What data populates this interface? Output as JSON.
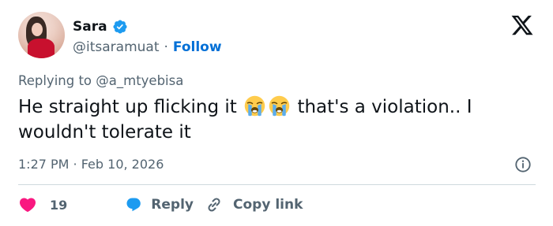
{
  "user": {
    "display_name": "Sara",
    "handle": "@itsaramuat",
    "separator": "·",
    "follow_label": "Follow"
  },
  "tweet": {
    "replying_to": "Replying to @a_mtyebisa",
    "text_part1": "He straight up flicking it",
    "text_part2": "that's a violation.. I wouldn't tolerate it",
    "emojis": [
      "loudly-crying-face",
      "loudly-crying-face"
    ],
    "timestamp": "1:27 PM · Feb 10, 2026"
  },
  "actions": {
    "likes_count": "19",
    "reply_label": "Reply",
    "copy_label": "Copy link"
  },
  "icons": {
    "verified": "verified-badge-icon",
    "logo": "x-logo-icon",
    "info": "info-icon",
    "like": "heart-icon",
    "reply": "comment-bubble-icon",
    "copy": "link-icon"
  },
  "colors": {
    "text_primary": "#0f1419",
    "text_secondary": "#536471",
    "follow_blue": "#006fd6",
    "verified_blue": "#1d9bf0",
    "heart_pink": "#f91880",
    "reply_blue": "#1d9bf0",
    "divider": "#cfd9de"
  }
}
